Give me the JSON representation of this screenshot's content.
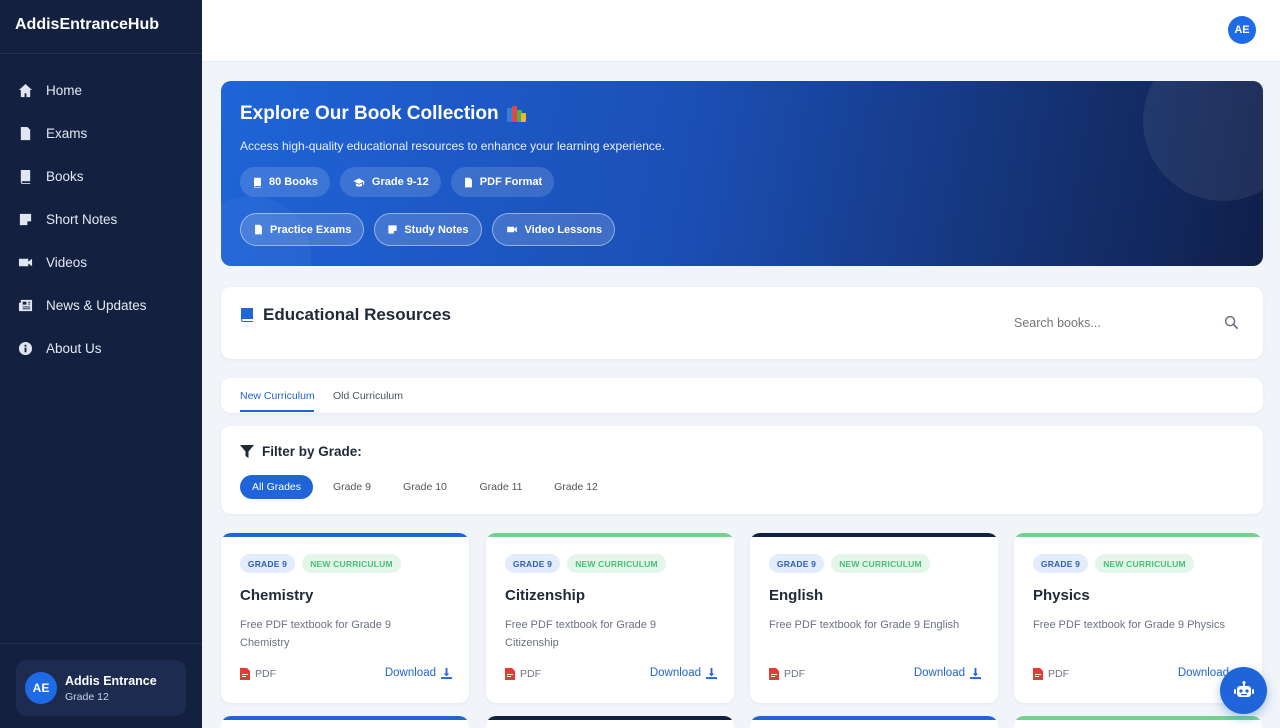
{
  "brand": "AddisEntranceHub",
  "sidebar": {
    "items": [
      {
        "label": "Home",
        "icon": "home-icon"
      },
      {
        "label": "Exams",
        "icon": "file-icon"
      },
      {
        "label": "Books",
        "icon": "book-icon"
      },
      {
        "label": "Short Notes",
        "icon": "note-icon"
      },
      {
        "label": "Videos",
        "icon": "video-icon"
      },
      {
        "label": "News & Updates",
        "icon": "newspaper-icon"
      },
      {
        "label": "About Us",
        "icon": "info-icon"
      }
    ],
    "user": {
      "initials": "AE",
      "name": "Addis Entrance",
      "grade": "Grade 12"
    }
  },
  "topbar": {
    "initials": "AE"
  },
  "hero": {
    "title": "Explore Our Book Collection",
    "subtitle": "Access high-quality educational resources to enhance your learning experience.",
    "stats": [
      {
        "label": "80 Books",
        "icon": "book-icon"
      },
      {
        "label": "Grade 9-12",
        "icon": "graduation-cap-icon"
      },
      {
        "label": "PDF Format",
        "icon": "pdf-file-icon"
      }
    ],
    "links": [
      {
        "label": "Practice Exams",
        "icon": "file-icon"
      },
      {
        "label": "Study Notes",
        "icon": "note-icon"
      },
      {
        "label": "Video Lessons",
        "icon": "video-icon"
      }
    ]
  },
  "resources": {
    "title": "Educational Resources",
    "search_placeholder": "Search books..."
  },
  "tabs": [
    {
      "label": "New Curriculum",
      "active": true
    },
    {
      "label": "Old Curriculum",
      "active": false
    }
  ],
  "filter": {
    "title": "Filter by Grade:",
    "grades": [
      {
        "label": "All Grades",
        "active": true
      },
      {
        "label": "Grade 9",
        "active": false
      },
      {
        "label": "Grade 10",
        "active": false
      },
      {
        "label": "Grade 11",
        "active": false
      },
      {
        "label": "Grade 12",
        "active": false
      }
    ]
  },
  "books": [
    {
      "grade": "GRADE 9",
      "curriculum": "NEW CURRICULUM",
      "title": "Chemistry",
      "desc": "Free PDF textbook for Grade 9 Chemistry",
      "format": "PDF",
      "action": "Download",
      "accent": "#1f64d8"
    },
    {
      "grade": "GRADE 9",
      "curriculum": "NEW CURRICULUM",
      "title": "Citizenship",
      "desc": "Free PDF textbook for Grade 9 Citizenship",
      "format": "PDF",
      "action": "Download",
      "accent": "#6fd38f"
    },
    {
      "grade": "GRADE 9",
      "curriculum": "NEW CURRICULUM",
      "title": "English",
      "desc": "Free PDF textbook for Grade 9 English",
      "format": "PDF",
      "action": "Download",
      "accent": "#13203f"
    },
    {
      "grade": "GRADE 9",
      "curriculum": "NEW CURRICULUM",
      "title": "Physics",
      "desc": "Free PDF textbook for Grade 9 Physics",
      "format": "PDF",
      "action": "Download",
      "accent": "#6fd38f"
    }
  ],
  "next_row_accents": [
    "#1f64d8",
    "#13203f",
    "#1f64d8",
    "#6fd38f"
  ],
  "colors": {
    "primary": "#1f64d8",
    "sidebar": "#13203f",
    "success": "#49c277",
    "pdf": "#e53935"
  }
}
